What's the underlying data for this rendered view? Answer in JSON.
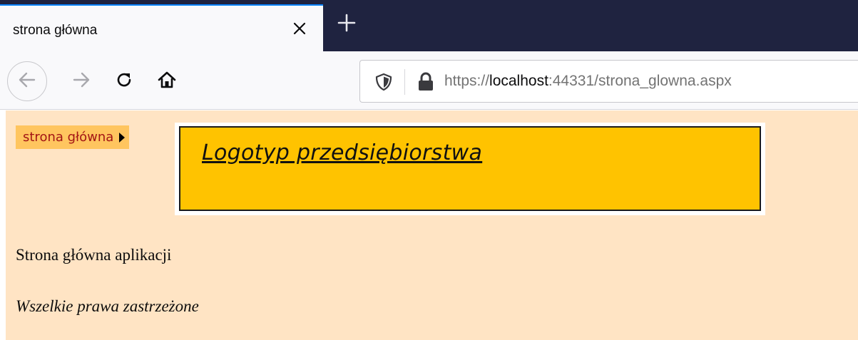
{
  "browser": {
    "tab": {
      "title": "strona główna"
    },
    "url": {
      "scheme": "https://",
      "host": "localhost",
      "rest": ":44331/strona_glowna.aspx"
    },
    "icons": {
      "close": "close-icon",
      "new_tab": "plus-icon",
      "back": "back-arrow-icon",
      "forward": "forward-arrow-icon",
      "reload": "reload-icon",
      "home": "home-icon",
      "shield": "shield-icon",
      "lock": "lock-icon"
    }
  },
  "page": {
    "background": "#ffe4c4",
    "menu": {
      "item_label": "strona główna"
    },
    "logo": {
      "text": "Logotyp przedsiębiorstwa"
    },
    "main_text": "Strona główna aplikacji",
    "footer_text": "Wszelkie prawa zastrzeżone"
  },
  "colors": {
    "tabstrip": "#1f2340",
    "accent": "#0a84ff",
    "menu_bg": "#ffc55f",
    "menu_text": "#a31515",
    "logo_bg": "#ffc300"
  }
}
